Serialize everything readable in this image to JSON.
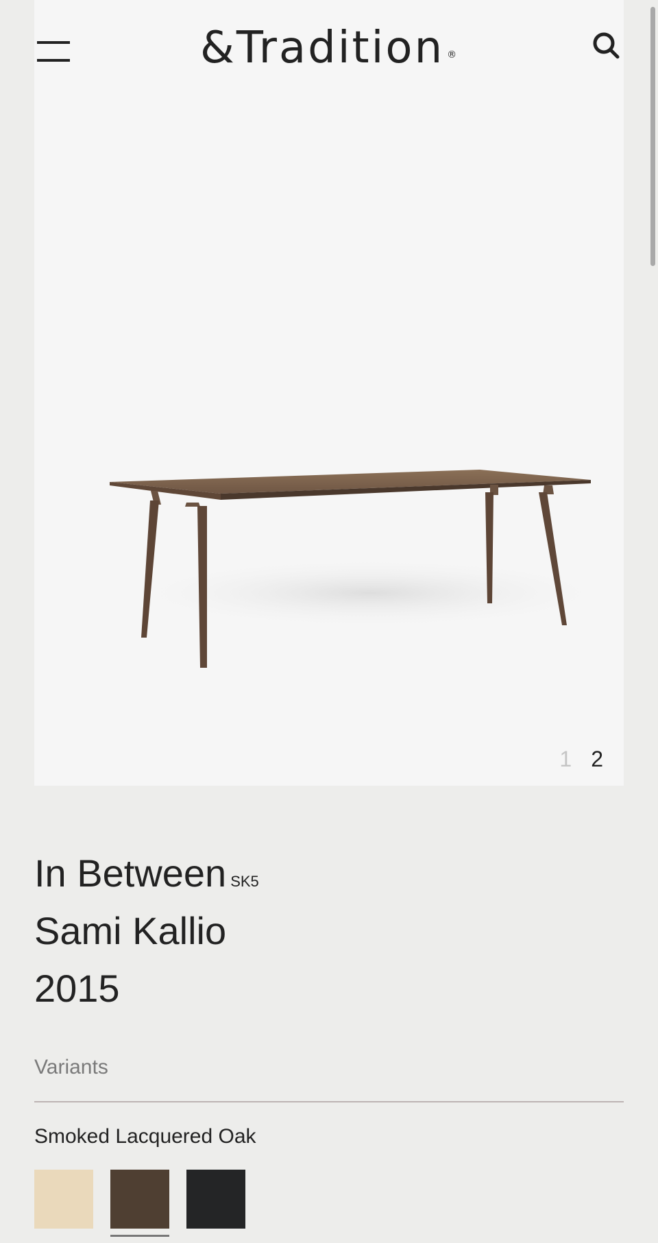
{
  "header": {
    "brand_name": "&Tradition",
    "brand_registered": "®",
    "menu_icon": "hamburger-menu-icon",
    "search_icon": "search-icon"
  },
  "gallery": {
    "pages": [
      "1",
      "2"
    ],
    "active_page": "2",
    "image_subject": "dining-table-product-image"
  },
  "product": {
    "name": "In Between",
    "model_code": "SK5",
    "designer": "Sami Kallio",
    "year": "2015"
  },
  "variants": {
    "label": "Variants",
    "selected": "Smoked Lacquered Oak",
    "swatches": [
      {
        "color": "#ead9bb",
        "selected": false
      },
      {
        "color": "#4f3f32",
        "selected": true
      },
      {
        "color": "#242526",
        "selected": false
      }
    ]
  },
  "colors": {
    "page_background": "#ededeb",
    "hero_background": "#f6f6f6",
    "text": "#222222",
    "muted_text": "#7a7a7a",
    "divider": "#bdb3b3"
  }
}
